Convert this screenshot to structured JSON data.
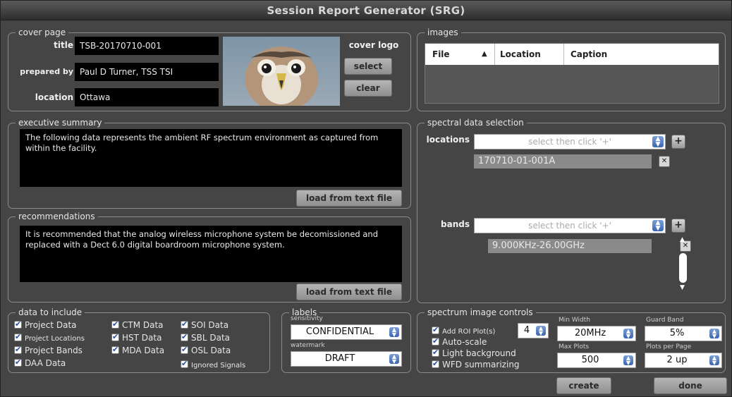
{
  "window": {
    "title": "Session Report Generator (SRG)"
  },
  "cover": {
    "legend": "cover page",
    "title_label": "title",
    "title_value": "TSB-20170710-001",
    "prepared_label": "prepared by",
    "prepared_value": "Paul D Turner, TSS TSI",
    "location_label": "location",
    "location_value": "Ottawa",
    "logo_label": "cover logo",
    "select_label": "select",
    "clear_label": "clear"
  },
  "images": {
    "legend": "images",
    "columns": [
      "File",
      "Location",
      "Caption"
    ]
  },
  "executive": {
    "legend": "executive summary",
    "text": "The following data represents the ambient RF spectrum environment as captured from within the facility.",
    "load_label": "load from text file"
  },
  "recommendations": {
    "legend": "recommendations",
    "text": "It is recommended that the analog wireless microphone system be decomissioned and replaced with a Dect 6.0 digital boardroom microphone system.",
    "load_label": "load from text file"
  },
  "spectral": {
    "legend": "spectral data selection",
    "locations_label": "locations",
    "locations_placeholder": "select then click '+'",
    "location_item": "170710-01-001A",
    "bands_label": "bands",
    "bands_placeholder": "select then click '+'",
    "band_item": "9.000KHz-26.00GHz"
  },
  "include": {
    "legend": "data to include",
    "items": [
      "Project Data",
      "CTM Data",
      "SOI Data",
      "Project Locations",
      "HST Data",
      "SBL Data",
      "Project Bands",
      "MDA Data",
      "OSL Data",
      "DAA Data",
      "Ignored Signals"
    ]
  },
  "labels": {
    "legend": "labels",
    "sensitivity_label": "sensitivity",
    "sensitivity_value": "CONFIDENTIAL",
    "watermark_label": "watermark",
    "watermark_value": "DRAFT"
  },
  "spectrum_controls": {
    "legend": "spectrum image controls",
    "add_roi_label": "Add ROI Plot(s)",
    "add_roi_value": "4",
    "autoscale_label": "Auto-scale",
    "light_bg_label": "Light background",
    "wfd_label": "WFD summarizing",
    "min_width_label": "Min Width",
    "min_width_value": "20MHz",
    "guard_band_label": "Guard Band",
    "guard_band_value": "5%",
    "max_plots_label": "Max Plots",
    "max_plots_value": "500",
    "plots_per_page_label": "Plots per Page",
    "plots_per_page_value": "2 up"
  },
  "footer": {
    "create_label": "create",
    "done_label": "done"
  },
  "colors": {
    "background": "#454545",
    "field": "#000000",
    "accent": "#3e66b0"
  }
}
